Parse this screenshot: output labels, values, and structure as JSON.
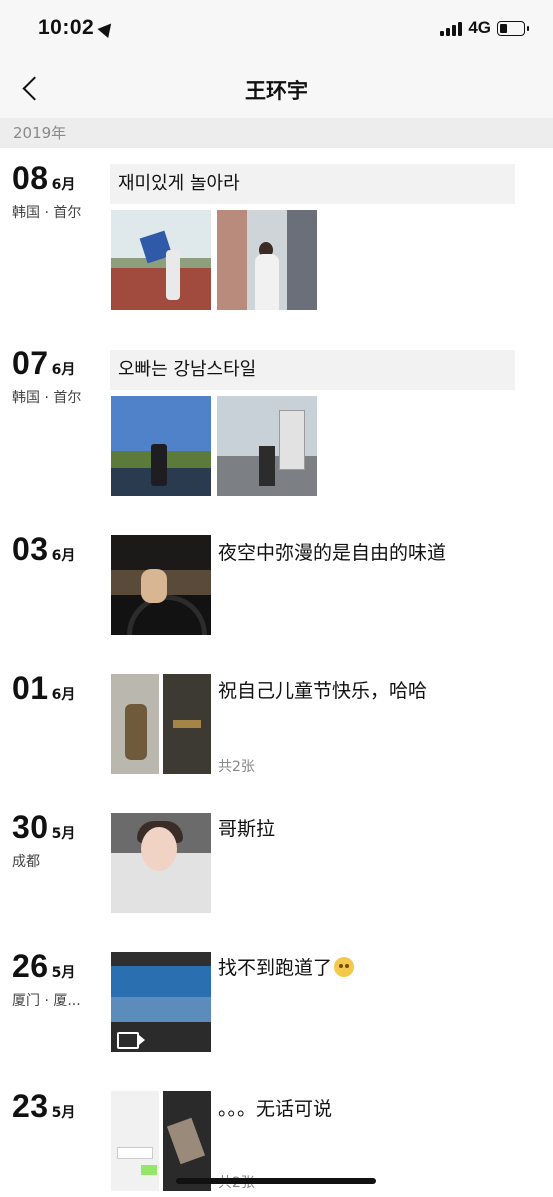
{
  "status": {
    "time": "10:02",
    "network": "4G"
  },
  "nav": {
    "title": "王环宇"
  },
  "year_label": "2019年",
  "posts": [
    {
      "day": "08",
      "month": "6月",
      "location": "韩国 · 首尔",
      "text": "재미있게 놀아라"
    },
    {
      "day": "07",
      "month": "6月",
      "location": "韩国 · 首尔",
      "text": "오빠는 강남스타일"
    },
    {
      "day": "03",
      "month": "6月",
      "location": "",
      "text": "夜空中弥漫的是自由的味道"
    },
    {
      "day": "01",
      "month": "6月",
      "location": "",
      "text": "祝自己儿童节快乐，哈哈",
      "count": "共2张"
    },
    {
      "day": "30",
      "month": "5月",
      "location": "成都",
      "text": "哥斯拉"
    },
    {
      "day": "26",
      "month": "5月",
      "location": "厦门 · 厦...",
      "text": "找不到跑道了"
    },
    {
      "day": "23",
      "month": "5月",
      "location": "",
      "text": "。。。无话可说",
      "count": "共2张"
    }
  ],
  "icons": {
    "back": "chevron-left-icon",
    "location_arrow": "location-arrow-icon",
    "signal": "signal-icon",
    "battery": "battery-icon",
    "video": "video-icon",
    "emoji": "crying-emoji-icon"
  }
}
